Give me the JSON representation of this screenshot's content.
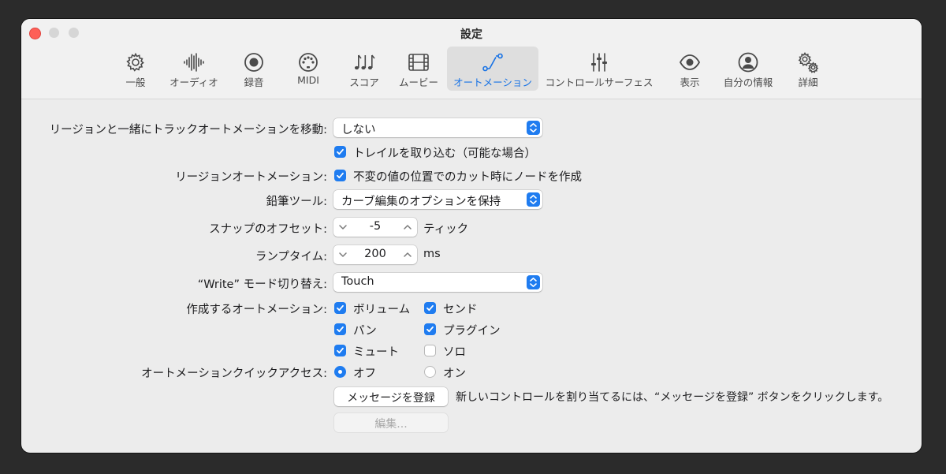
{
  "window": {
    "title": "設定"
  },
  "tabs": [
    {
      "id": "general",
      "label": "一般",
      "icon": "gear-icon"
    },
    {
      "id": "audio",
      "label": "オーディオ",
      "icon": "waveform-icon"
    },
    {
      "id": "recording",
      "label": "録音",
      "icon": "record-icon"
    },
    {
      "id": "midi",
      "label": "MIDI",
      "icon": "midi-port-icon"
    },
    {
      "id": "score",
      "label": "スコア",
      "icon": "music-notes-icon"
    },
    {
      "id": "movie",
      "label": "ムービー",
      "icon": "film-icon"
    },
    {
      "id": "automation",
      "label": "オートメーション",
      "icon": "automation-curve-icon",
      "active": true
    },
    {
      "id": "control-surfaces",
      "label": "コントロールサーフェス",
      "icon": "sliders-icon"
    },
    {
      "id": "view",
      "label": "表示",
      "icon": "eye-icon"
    },
    {
      "id": "my-info",
      "label": "自分の情報",
      "icon": "person-icon"
    },
    {
      "id": "advanced",
      "label": "詳細",
      "icon": "gears-icon"
    }
  ],
  "settings": {
    "move_with_regions": {
      "label": "リージョンと一緒にトラックオートメーションを移動:",
      "value": "しない"
    },
    "include_trail": {
      "label": "トレイルを取り込む（可能な場合）",
      "checked": true
    },
    "region_automation": {
      "label": "リージョンオートメーション:",
      "option_label": "不変の値の位置でのカット時にノードを作成",
      "checked": true
    },
    "pencil_tool": {
      "label": "鉛筆ツール:",
      "value": "カーブ編集のオプションを保持"
    },
    "snap_offset": {
      "label": "スナップのオフセット:",
      "value": "-5",
      "unit": "ティック"
    },
    "ramp_time": {
      "label": "ランプタイム:",
      "value": "200",
      "unit": "ms"
    },
    "write_mode": {
      "label": "“Write” モード切り替え:",
      "value": "Touch"
    },
    "create_automation": {
      "label": "作成するオートメーション:",
      "options": [
        {
          "label": "ボリューム",
          "checked": true
        },
        {
          "label": "センド",
          "checked": true
        },
        {
          "label": "パン",
          "checked": true
        },
        {
          "label": "プラグイン",
          "checked": true
        },
        {
          "label": "ミュート",
          "checked": true
        },
        {
          "label": "ソロ",
          "checked": false
        }
      ]
    },
    "quick_access": {
      "label": "オートメーションクイックアクセス:",
      "options": [
        {
          "label": "オフ",
          "selected": true
        },
        {
          "label": "オン",
          "selected": false
        }
      ]
    },
    "learn_message": {
      "button_label": "メッセージを登録",
      "hint": "新しいコントロールを割り当てるには、“メッセージを登録” ボタンをクリックします。"
    },
    "edit_button": {
      "label": "編集..."
    }
  },
  "colors": {
    "accent": "#1f7cf0",
    "active_tab_text": "#1571e5",
    "close": "#fe5f57"
  }
}
